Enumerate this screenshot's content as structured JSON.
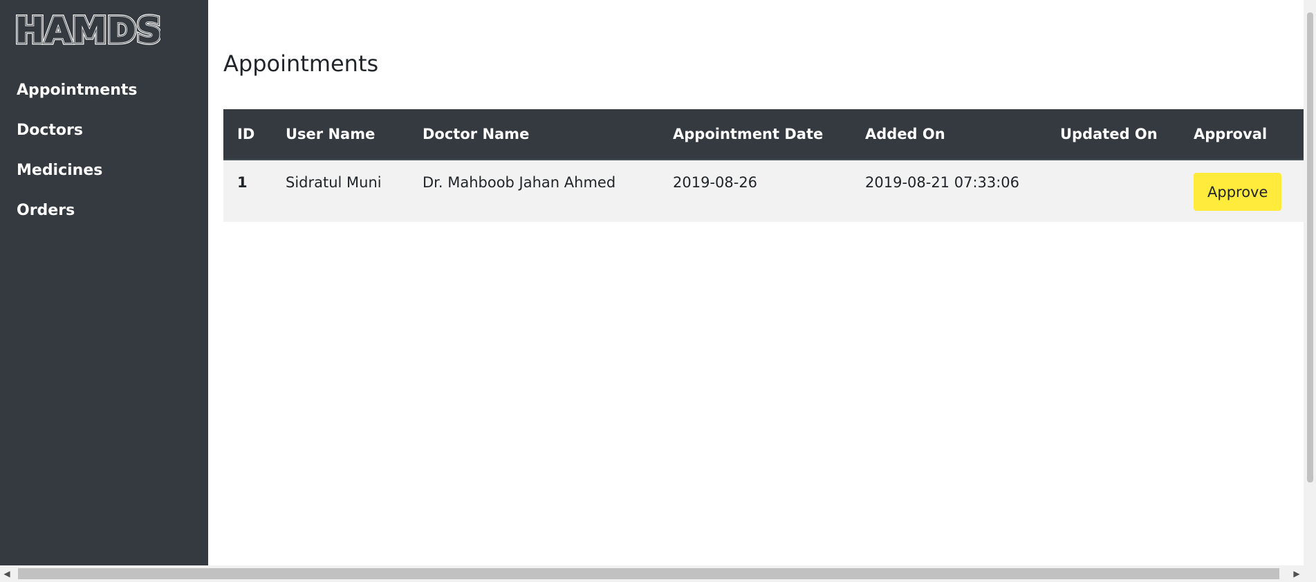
{
  "brand": {
    "logo_text": "HAMDS"
  },
  "sidebar": {
    "items": [
      {
        "label": "Appointments"
      },
      {
        "label": "Doctors"
      },
      {
        "label": "Medicines"
      },
      {
        "label": "Orders"
      }
    ]
  },
  "main": {
    "title": "Appointments",
    "table": {
      "columns": [
        "ID",
        "User Name",
        "Doctor Name",
        "Appointment Date",
        "Added On",
        "Updated On",
        "Approval"
      ],
      "rows": [
        {
          "id": "1",
          "user_name": "Sidratul Muni",
          "doctor_name": "Dr. Mahboob Jahan Ahmed",
          "appointment_date": "2019-08-26",
          "added_on": "2019-08-21 07:33:06",
          "updated_on": "",
          "approval_button": "Approve"
        }
      ]
    }
  },
  "colors": {
    "sidebar_bg": "#343a40",
    "header_bg": "#343a40",
    "row_bg": "#f2f2f2",
    "approve_button": "#ffeb3b"
  },
  "icons": {
    "scroll_left": "triangle-left-icon",
    "scroll_right": "triangle-right-icon"
  }
}
